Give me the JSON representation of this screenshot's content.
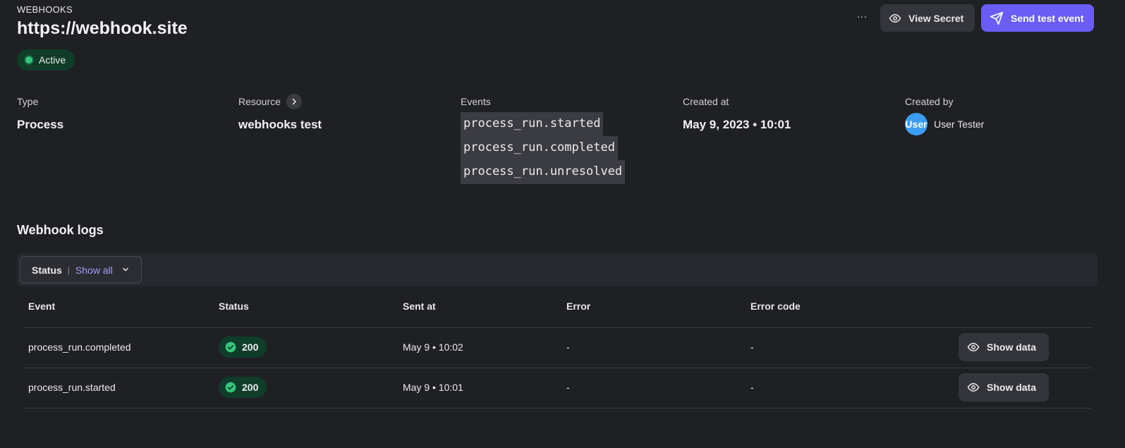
{
  "header": {
    "breadcrumb": "WEBHOOKS",
    "title": "https://webhook.site",
    "status": "Active",
    "more_label": "···",
    "view_secret_label": "View Secret",
    "send_test_label": "Send test event"
  },
  "info": {
    "type_label": "Type",
    "type_value": "Process",
    "resource_label": "Resource",
    "resource_value": "webhooks test",
    "events_label": "Events",
    "events": [
      "process_run.started",
      "process_run.completed",
      "process_run.unresolved"
    ],
    "created_at_label": "Created at",
    "created_at_value": "May 9, 2023 • 10:01",
    "created_by_label": "Created by",
    "avatar_text": "User",
    "created_by_value": "User Tester"
  },
  "logs": {
    "title": "Webhook logs",
    "filter_label": "Status",
    "filter_sep": "|",
    "filter_value": "Show all",
    "columns": [
      "Event",
      "Status",
      "Sent at",
      "Error",
      "Error code"
    ],
    "rows": [
      {
        "event": "process_run.completed",
        "status": "200",
        "sent_at": "May 9 • 10:02",
        "error": "-",
        "error_code": "-",
        "action": "Show data"
      },
      {
        "event": "process_run.started",
        "status": "200",
        "sent_at": "May 9 • 10:01",
        "error": "-",
        "error_code": "-",
        "action": "Show data"
      }
    ]
  },
  "colors": {
    "background": "#1f2024",
    "accent": "#6b5cf5",
    "success": "#34c77b",
    "success_bg": "#0f3d2a",
    "avatar": "#3c9df5"
  },
  "icons": {
    "view_secret": "eye-icon",
    "send_test": "paper-plane-icon",
    "resource": "chevron-right-icon",
    "filter": "chevron-down-icon",
    "status_ok": "check-circle-icon",
    "show_data": "eye-icon"
  }
}
